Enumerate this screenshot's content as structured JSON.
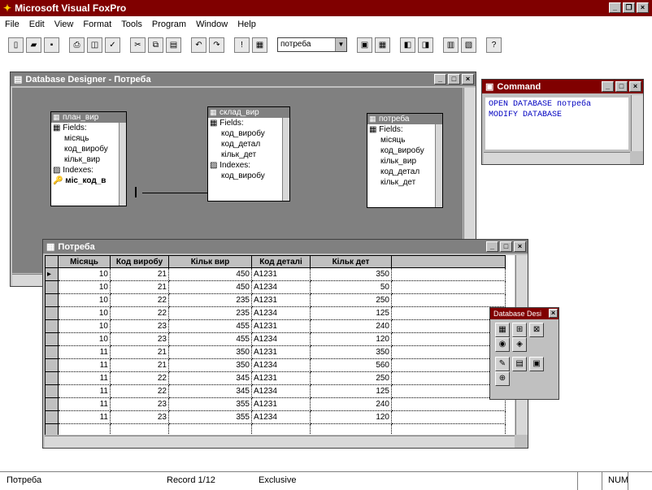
{
  "app": {
    "title": "Microsoft Visual FoxPro"
  },
  "menu": [
    "File",
    "Edit",
    "View",
    "Format",
    "Tools",
    "Program",
    "Window",
    "Help"
  ],
  "toolbar": {
    "combo_value": "потреба"
  },
  "designer": {
    "title": "Database Designer - Потреба",
    "tables": [
      {
        "name": "план_вир",
        "fields_label": "Fields:",
        "fields": [
          "місяць",
          "код_виробу",
          "кільк_вир"
        ],
        "indexes_label": "Indexes:",
        "index": "міс_код_в"
      },
      {
        "name": "склад_вир",
        "fields_label": "Fields:",
        "fields": [
          "код_виробу",
          "код_детал",
          "кільк_дет"
        ],
        "indexes_label": "Indexes:",
        "index": "код_виробу"
      },
      {
        "name": "потреба",
        "fields_label": "Fields:",
        "fields": [
          "місяць",
          "код_виробу",
          "кільк_вир",
          "код_детал",
          "кільк_дет"
        ]
      }
    ]
  },
  "command": {
    "title": "Command",
    "lines": [
      "OPEN DATABASE потреба",
      "MODIFY DATABASE"
    ]
  },
  "browse": {
    "title": "Потреба",
    "columns": [
      "Місяць",
      "Код виробу",
      "Кільк вир",
      "Код деталі",
      "Кільк дет"
    ],
    "rows": [
      [
        "10",
        "21",
        "450",
        "A1231",
        "350"
      ],
      [
        "10",
        "21",
        "450",
        "A1234",
        "50"
      ],
      [
        "10",
        "22",
        "235",
        "A1231",
        "250"
      ],
      [
        "10",
        "22",
        "235",
        "A1234",
        "125"
      ],
      [
        "10",
        "23",
        "455",
        "A1231",
        "240"
      ],
      [
        "10",
        "23",
        "455",
        "A1234",
        "120"
      ],
      [
        "11",
        "21",
        "350",
        "A1231",
        "350"
      ],
      [
        "11",
        "21",
        "350",
        "A1234",
        "560"
      ],
      [
        "11",
        "22",
        "345",
        "A1231",
        "250"
      ],
      [
        "11",
        "22",
        "345",
        "A1234",
        "125"
      ],
      [
        "11",
        "23",
        "355",
        "A1231",
        "240"
      ],
      [
        "11",
        "23",
        "355",
        "A1234",
        "120"
      ]
    ]
  },
  "palette": {
    "title": "Database Desi"
  },
  "status": {
    "left": "Потреба",
    "record": "Record 1/12",
    "mode": "Exclusive",
    "num": "NUM"
  }
}
